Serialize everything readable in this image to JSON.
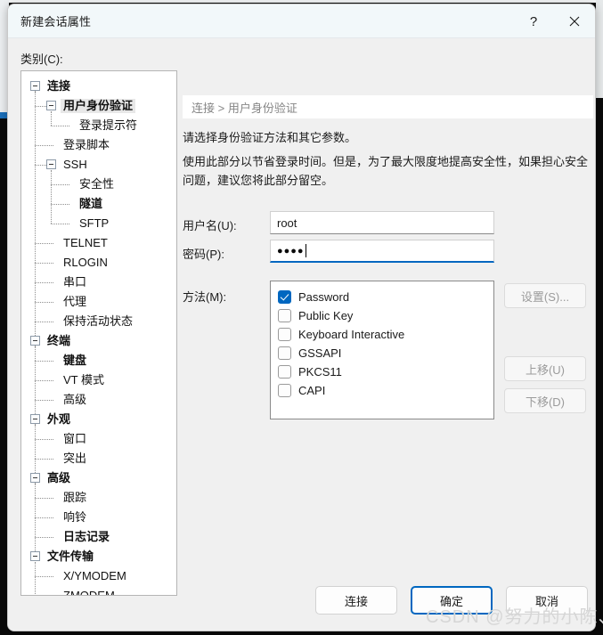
{
  "window": {
    "title": "新建会话属性",
    "help_icon": "question-mark-icon",
    "close_icon": "close-icon"
  },
  "category": {
    "label": "类别(C):",
    "tree": [
      {
        "label": "连接",
        "level": 0,
        "bold": true,
        "expander": true,
        "selected": false
      },
      {
        "label": "用户身份验证",
        "level": 1,
        "bold": true,
        "expander": true,
        "selected": true
      },
      {
        "label": "登录提示符",
        "level": 2,
        "bold": false,
        "expander": false,
        "selected": false
      },
      {
        "label": "登录脚本",
        "level": 1,
        "bold": false,
        "expander": false,
        "selected": false
      },
      {
        "label": "SSH",
        "level": 1,
        "bold": false,
        "expander": true,
        "selected": false
      },
      {
        "label": "安全性",
        "level": 2,
        "bold": false,
        "expander": false,
        "selected": false
      },
      {
        "label": "隧道",
        "level": 2,
        "bold": true,
        "expander": false,
        "selected": false
      },
      {
        "label": "SFTP",
        "level": 2,
        "bold": false,
        "expander": false,
        "selected": false
      },
      {
        "label": "TELNET",
        "level": 1,
        "bold": false,
        "expander": false,
        "selected": false
      },
      {
        "label": "RLOGIN",
        "level": 1,
        "bold": false,
        "expander": false,
        "selected": false
      },
      {
        "label": "串口",
        "level": 1,
        "bold": false,
        "expander": false,
        "selected": false
      },
      {
        "label": "代理",
        "level": 1,
        "bold": false,
        "expander": false,
        "selected": false
      },
      {
        "label": "保持活动状态",
        "level": 1,
        "bold": false,
        "expander": false,
        "selected": false
      },
      {
        "label": "终端",
        "level": 0,
        "bold": true,
        "expander": true,
        "selected": false
      },
      {
        "label": "键盘",
        "level": 1,
        "bold": true,
        "expander": false,
        "selected": false
      },
      {
        "label": "VT 模式",
        "level": 1,
        "bold": false,
        "expander": false,
        "selected": false
      },
      {
        "label": "高级",
        "level": 1,
        "bold": false,
        "expander": false,
        "selected": false
      },
      {
        "label": "外观",
        "level": 0,
        "bold": true,
        "expander": true,
        "selected": false
      },
      {
        "label": "窗口",
        "level": 1,
        "bold": false,
        "expander": false,
        "selected": false
      },
      {
        "label": "突出",
        "level": 1,
        "bold": false,
        "expander": false,
        "selected": false
      },
      {
        "label": "高级",
        "level": 0,
        "bold": true,
        "expander": true,
        "selected": false
      },
      {
        "label": "跟踪",
        "level": 1,
        "bold": false,
        "expander": false,
        "selected": false
      },
      {
        "label": "响铃",
        "level": 1,
        "bold": false,
        "expander": false,
        "selected": false
      },
      {
        "label": "日志记录",
        "level": 1,
        "bold": true,
        "expander": false,
        "selected": false
      },
      {
        "label": "文件传输",
        "level": 0,
        "bold": true,
        "expander": true,
        "selected": false
      },
      {
        "label": "X/YMODEM",
        "level": 1,
        "bold": false,
        "expander": false,
        "selected": false
      },
      {
        "label": "ZMODEM",
        "level": 1,
        "bold": false,
        "expander": false,
        "selected": false
      }
    ]
  },
  "panel": {
    "breadcrumb": "连接 > 用户身份验证",
    "description_line1": "请选择身份验证方法和其它参数。",
    "description_line2": "使用此部分以节省登录时间。但是，为了最大限度地提高安全性，如果担心安全问题，建议您将此部分留空。",
    "username": {
      "label": "用户名(U):",
      "value": "root"
    },
    "password": {
      "label": "密码(P):",
      "masked_value": "●●●●",
      "char_count": 4,
      "focused": true
    },
    "methods": {
      "label": "方法(M):",
      "items": [
        {
          "label": "Password",
          "checked": true
        },
        {
          "label": "Public Key",
          "checked": false
        },
        {
          "label": "Keyboard Interactive",
          "checked": false
        },
        {
          "label": "GSSAPI",
          "checked": false
        },
        {
          "label": "PKCS11",
          "checked": false
        },
        {
          "label": "CAPI",
          "checked": false
        }
      ]
    },
    "side_buttons": [
      {
        "label": "设置(S)...",
        "enabled": false
      },
      {
        "label": "上移(U)",
        "enabled": false
      },
      {
        "label": "下移(D)",
        "enabled": false
      }
    ]
  },
  "footer": {
    "connect_label": "连接",
    "ok_label": "确定",
    "cancel_label": "取消",
    "default_button": "确定"
  },
  "watermark": {
    "text": "CSDN @努力的小陈、"
  },
  "colors": {
    "accent": "#0067c0",
    "dialog_bg": "#f0f0f0",
    "titlebar_bg": "#f2f8fa",
    "panel_bg": "#ffffff",
    "breadcrumb_text": "#868686",
    "disabled_text": "#9b9b9b",
    "watermark": "#d6d6d6",
    "desktop_bg": "#0a0a0a"
  }
}
